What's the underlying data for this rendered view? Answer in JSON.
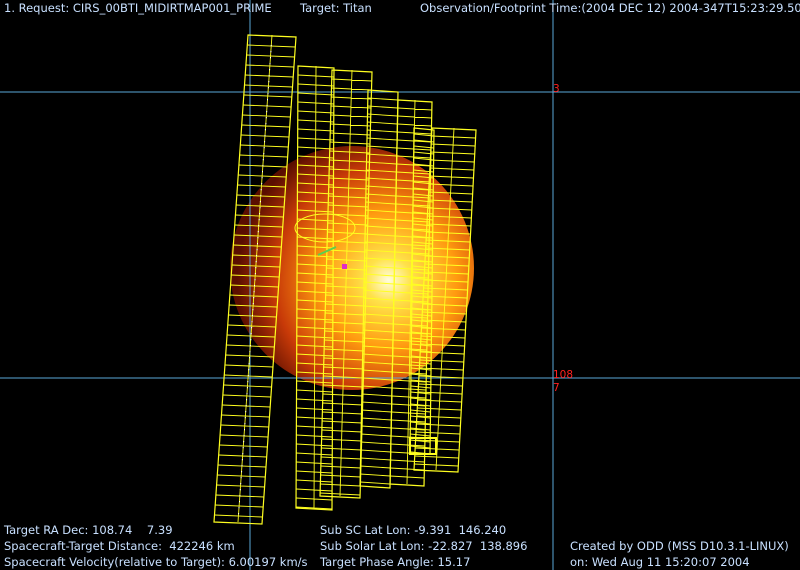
{
  "header": {
    "request": "1. Request: CIRS_00BTI_MIDIRTMAP001_PRIME",
    "target": "Target: Titan",
    "obs_time": "Observation/Footprint Time:(2004 DEC 12) 2004-347T15:23:29.50"
  },
  "grid_labels": {
    "lat_top": "3",
    "lon_mid": "108",
    "lat_mid": "7"
  },
  "footer": {
    "target_ra_dec": "Target RA Dec: 108.74    7.39",
    "sc_target_distance": "Spacecraft-Target Distance:  422246 km",
    "sc_velocity": "Spacecraft Velocity(relative to Target): 6.00197 km/s",
    "sub_sc": "Sub SC Lat Lon: -9.391  146.240",
    "sub_solar": "Sub Solar Lat Lon: -22.827  138.896",
    "phase_angle": "Target Phase Angle: 15.17",
    "created_by": "Created by ODD (MSS D10.3.1-LINUX)",
    "created_on": "on: Wed Aug 11 15:20:07 2004"
  },
  "colors": {
    "background": "#000000",
    "grid": "#5aa8d8",
    "footprint": "#ffff20",
    "text": "#c8e0ff",
    "label": "#ff2020"
  }
}
